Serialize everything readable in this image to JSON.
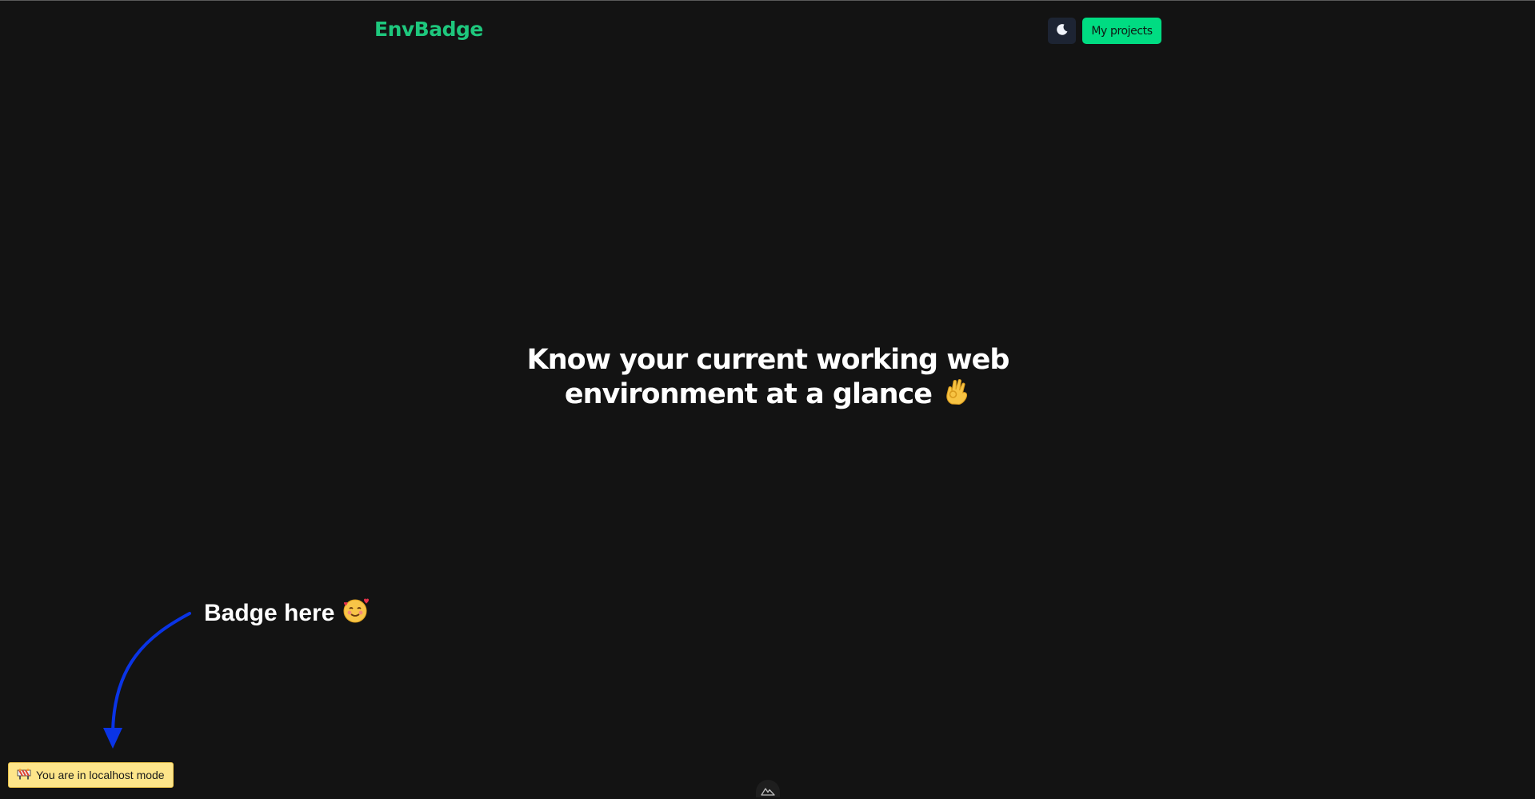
{
  "header": {
    "logo_text": "EnvBadge",
    "projects_label": "My projects",
    "theme_icon": "moon-icon"
  },
  "hero": {
    "line1": "Know your current working web",
    "line2": "environment at a glance",
    "emoji_icon": "ok-hand-emoji"
  },
  "callout": {
    "text": "Badge here",
    "emoji_icon": "smiling-hearts-emoji"
  },
  "badge": {
    "icon": "construction-icon",
    "text": "You are in localhost mode"
  },
  "footer": {
    "logo_icon": "nuxt-logo-icon"
  },
  "colors": {
    "background": "#131313",
    "brand_green": "#1ec77d",
    "button_green": "#00dc82",
    "badge_yellow": "#fde58a",
    "arrow_blue": "#0a34e6"
  }
}
